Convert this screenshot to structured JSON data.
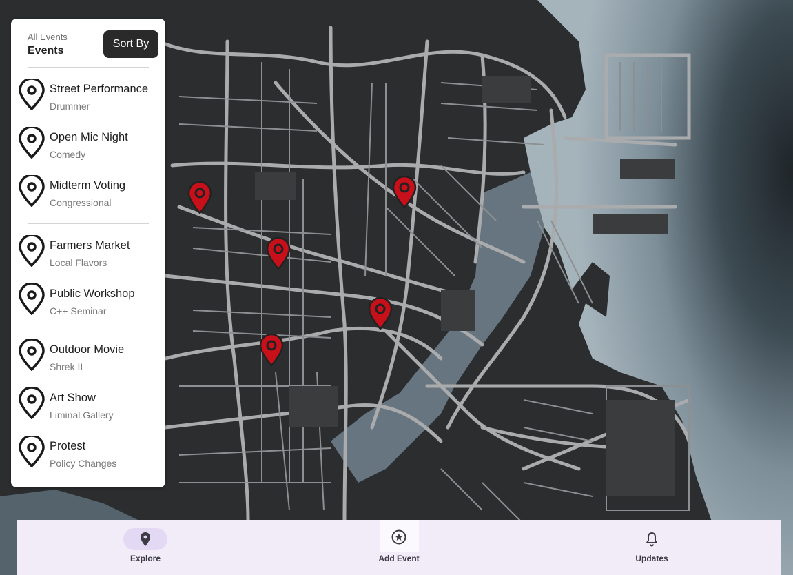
{
  "panel": {
    "crumb": "All Events",
    "title": "Events",
    "sort_label": "Sort By"
  },
  "events": [
    {
      "title": "Street Performance",
      "subtitle": "Drummer",
      "icon": "location-pin-icon"
    },
    {
      "title": "Open Mic Night",
      "subtitle": "Comedy",
      "icon": "location-pin-icon"
    },
    {
      "title": "Midterm Voting",
      "subtitle": "Congressional",
      "icon": "location-pin-icon"
    },
    {
      "title": "Farmers Market",
      "subtitle": "Local Flavors",
      "icon": "location-pin-icon"
    },
    {
      "title": "Public Workshop",
      "subtitle": "C++ Seminar",
      "icon": "location-pin-icon"
    },
    {
      "title": "Outdoor Movie",
      "subtitle": "Shrek II",
      "icon": "location-pin-icon"
    },
    {
      "title": "Art Show",
      "subtitle": "Liminal Gallery",
      "icon": "location-pin-icon"
    },
    {
      "title": "Protest",
      "subtitle": "Policy Changes",
      "icon": "location-pin-icon"
    }
  ],
  "map": {
    "marker_count": 5,
    "marker_color": "#c8101a",
    "land_color": "#2b2d2f",
    "road_color": "#a9abad",
    "water_color": "#5c6e7a"
  },
  "nav": {
    "items": [
      {
        "label": "Explore",
        "icon": "location-pin-icon",
        "active": true
      },
      {
        "label": "Add Event",
        "icon": "star-circle-icon",
        "active": false
      },
      {
        "label": "Updates",
        "icon": "bell-icon",
        "active": false
      }
    ],
    "background": "#f2ecf8",
    "active_pill": "#e4d9f5"
  }
}
